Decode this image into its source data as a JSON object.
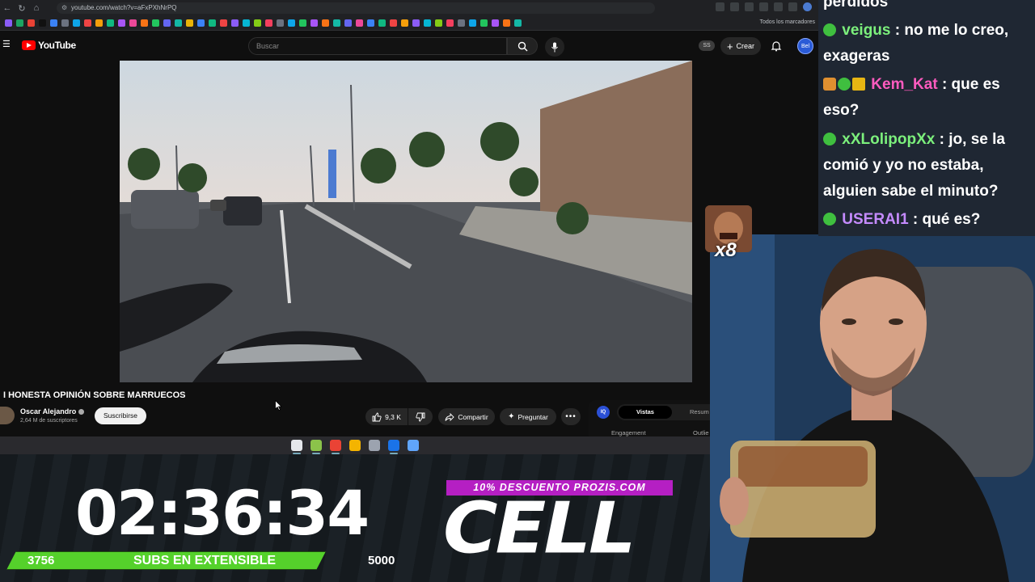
{
  "browser": {
    "url": "youtube.com/watch?v=aFxPXhNrPQ",
    "bookmarks_folder": "Todos los marcadores",
    "bookmark_colors": [
      "#8a5cf6",
      "#1da462",
      "#e94235",
      "#111111",
      "#3b82f6",
      "#6b7280",
      "#0ea5e9",
      "#ef4444",
      "#f59e0b",
      "#10b981",
      "#a855f7",
      "#ec4899",
      "#f97316",
      "#22c55e",
      "#6366f1",
      "#14b8a6",
      "#eab308",
      "#3b82f6",
      "#10b981",
      "#ef4444",
      "#8b5cf6",
      "#06b6d4",
      "#84cc16",
      "#f43f5e",
      "#6b7280",
      "#0ea5e9",
      "#22c55e",
      "#a855f7",
      "#f97316",
      "#14b8a6",
      "#6366f1",
      "#ec4899",
      "#3b82f6",
      "#10b981",
      "#ef4444",
      "#f59e0b",
      "#8b5cf6",
      "#06b6d4",
      "#84cc16",
      "#f43f5e",
      "#6b7280",
      "#0ea5e9",
      "#22c55e",
      "#a855f7",
      "#f97316",
      "#14b8a6"
    ]
  },
  "youtube": {
    "logo_text": "YouTube",
    "search_placeholder": "Buscar",
    "ss_badge": "SS",
    "create_label": "Crear",
    "avatar_text": "Bel",
    "video_title": "I HONESTA OPINIÓN SOBRE MARRUECOS",
    "channel_name": "Oscar Alejandro",
    "channel_subs": "2,64 M de suscriptores",
    "subscribe_label": "Suscribirse",
    "likes": "9,3 K",
    "share_label": "Compartir",
    "ask_label": "Preguntar",
    "iq": {
      "logo": "IQ",
      "tab_active": "Vistas",
      "tab_other": "Resum",
      "engagement": "Engagement",
      "outlier": "Outlie"
    }
  },
  "taskbar_colors": [
    "#e5e7eb",
    "#8bc34a",
    "#ea4335",
    "#f4b400",
    "#9ca3af",
    "#1a73e8",
    "#60a5fa"
  ],
  "overlay": {
    "timer": "02:36:34",
    "subs_current": "3756",
    "subs_label": "SUBS EN EXTENSIBLE",
    "subs_goal": "5000",
    "promo": "10% DESCUENTO PROZIS.COM",
    "brand": "CELL",
    "accent": "#55d12b",
    "promo_color": "#b51fc3"
  },
  "chat": {
    "partial_top": "perdidos",
    "messages": [
      {
        "user": "veigus",
        "color": "#7cf07c",
        "text": ": no me lo creo,",
        "cont": "exageras"
      },
      {
        "user": "Kem_Kat",
        "color": "#ff5bbf",
        "text": ": que es",
        "cont": "eso?"
      },
      {
        "user": "xXLolipopXx",
        "color": "#7cf07c",
        "text": ": jo, se la",
        "cont": "comió y yo no estaba,",
        "cont2": "alguien sabe el minuto?"
      },
      {
        "user": "USERAI1",
        "color": "#c58bff",
        "text": ": qué es?"
      }
    ],
    "emote_count": "x8"
  }
}
